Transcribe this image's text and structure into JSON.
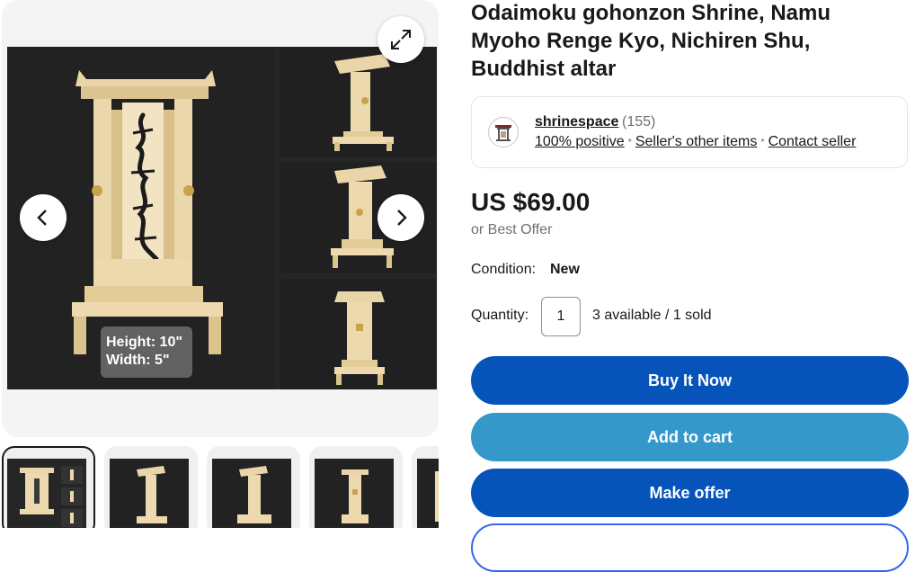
{
  "listing": {
    "title": "Odaimoku gohonzon Shrine, Namu Myoho Renge Kyo, Nichiren Shu, Buddhist altar"
  },
  "gallery": {
    "overlay_line1": "Height: 10\"",
    "overlay_line2": "Width: 5\"",
    "expand_icon": "expand-icon",
    "prev_icon": "chevron-left-icon",
    "next_icon": "chevron-right-icon",
    "selected_thumbnail": 1,
    "thumbnail_count": 5
  },
  "seller": {
    "name": "shrinespace",
    "count": "(155)",
    "positive": "100% positive",
    "other_items": "Seller's other items",
    "contact": "Contact seller",
    "separator": "•"
  },
  "pricing": {
    "price": "US $69.00",
    "best_offer": "or Best Offer"
  },
  "condition": {
    "label": "Condition:",
    "value": "New"
  },
  "quantity": {
    "label": "Quantity:",
    "value": "1",
    "availability": "3 available / 1 sold"
  },
  "actions": {
    "buy_now": "Buy It Now",
    "add_to_cart": "Add to cart",
    "make_offer": "Make offer"
  },
  "colors": {
    "primary_button": "#0654ba",
    "secondary_button": "#3498ca",
    "shrine_wood": "#ecd9ae",
    "photo_background": "#222222"
  }
}
